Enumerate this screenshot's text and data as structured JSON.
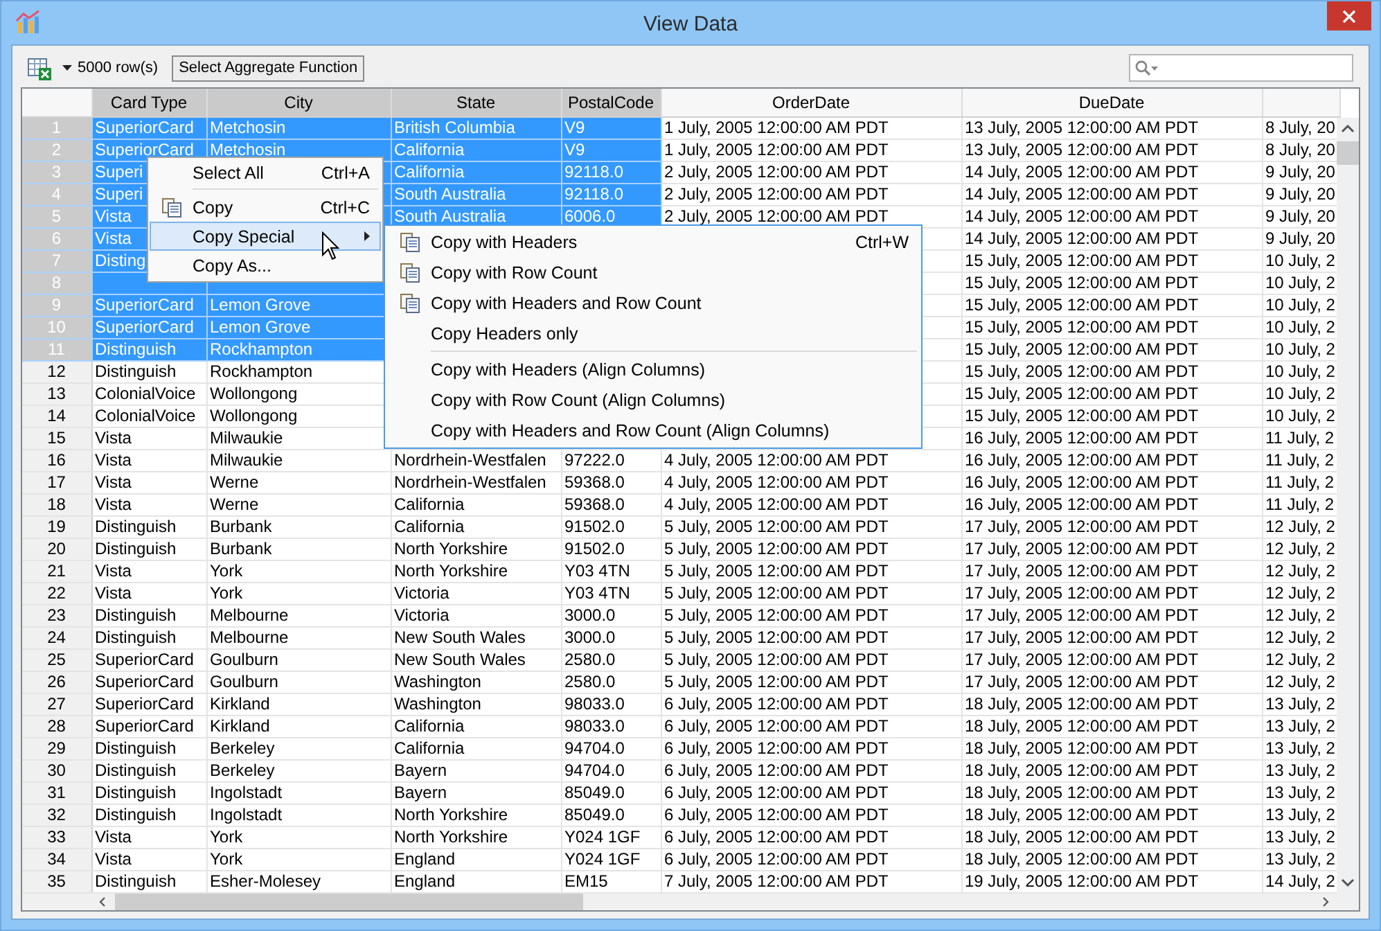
{
  "window": {
    "title": "View Data"
  },
  "toolbar": {
    "row_count": "5000 row(s)",
    "aggregate_button": "Select Aggregate Function"
  },
  "table": {
    "columns": [
      {
        "label": "Card Type",
        "selected": true
      },
      {
        "label": "City",
        "selected": true
      },
      {
        "label": "State",
        "selected": true
      },
      {
        "label": "PostalCode",
        "selected": true
      },
      {
        "label": "OrderDate",
        "selected": false
      },
      {
        "label": "DueDate",
        "selected": false
      }
    ],
    "rows": [
      {
        "number": "1",
        "selected": true,
        "cells": [
          "SuperiorCard",
          "Metchosin",
          "British Columbia",
          "V9",
          "1 July, 2005 12:00:00 AM PDT",
          "13 July, 2005 12:00:00 AM PDT",
          "8 July, 20"
        ]
      },
      {
        "number": "2",
        "selected": true,
        "cells": [
          "SuperiorCard",
          "Metchosin",
          "California",
          "V9",
          "1 July, 2005 12:00:00 AM PDT",
          "13 July, 2005 12:00:00 AM PDT",
          "8 July, 20"
        ]
      },
      {
        "number": "3",
        "selected": true,
        "cells": [
          "Superi",
          null,
          "California",
          "92118.0",
          "2 July, 2005 12:00:00 AM PDT",
          "14 July, 2005 12:00:00 AM PDT",
          "9 July, 20"
        ]
      },
      {
        "number": "4",
        "selected": true,
        "cells": [
          "Superi",
          null,
          "South Australia",
          "92118.0",
          "2 July, 2005 12:00:00 AM PDT",
          "14 July, 2005 12:00:00 AM PDT",
          "9 July, 20"
        ]
      },
      {
        "number": "5",
        "selected": true,
        "cells": [
          "Vista",
          null,
          "South Australia",
          "6006.0",
          "2 July, 2005 12:00:00 AM PDT",
          "14 July, 2005 12:00:00 AM PDT",
          "9 July, 20"
        ]
      },
      {
        "number": "6",
        "selected": true,
        "cells": [
          "Vista",
          null,
          null,
          null,
          null,
          "14 July, 2005 12:00:00 AM PDT",
          "9 July, 20"
        ]
      },
      {
        "number": "7",
        "selected": true,
        "cells": [
          "Disting",
          null,
          null,
          null,
          null,
          "15 July, 2005 12:00:00 AM PDT",
          "10 July, 2"
        ]
      },
      {
        "number": "8",
        "selected": true,
        "cells": [
          null,
          null,
          null,
          null,
          null,
          "15 July, 2005 12:00:00 AM PDT",
          "10 July, 2"
        ]
      },
      {
        "number": "9",
        "selected": true,
        "cells": [
          "SuperiorCard",
          "Lemon Grove",
          null,
          null,
          null,
          "15 July, 2005 12:00:00 AM PDT",
          "10 July, 2"
        ]
      },
      {
        "number": "10",
        "selected": true,
        "cells": [
          "SuperiorCard",
          "Lemon Grove",
          null,
          null,
          null,
          "15 July, 2005 12:00:00 AM PDT",
          "10 July, 2"
        ]
      },
      {
        "number": "11",
        "selected": true,
        "cells": [
          "Distinguish",
          "Rockhampton",
          null,
          null,
          null,
          "15 July, 2005 12:00:00 AM PDT",
          "10 July, 2"
        ]
      },
      {
        "number": "12",
        "selected": false,
        "cells": [
          "Distinguish",
          "Rockhampton",
          null,
          null,
          null,
          "15 July, 2005 12:00:00 AM PDT",
          "10 July, 2"
        ]
      },
      {
        "number": "13",
        "selected": false,
        "cells": [
          "ColonialVoice",
          "Wollongong",
          null,
          null,
          null,
          "15 July, 2005 12:00:00 AM PDT",
          "10 July, 2"
        ]
      },
      {
        "number": "14",
        "selected": false,
        "cells": [
          "ColonialVoice",
          "Wollongong",
          null,
          null,
          null,
          "15 July, 2005 12:00:00 AM PDT",
          "10 July, 2"
        ]
      },
      {
        "number": "15",
        "selected": false,
        "cells": [
          "Vista",
          "Milwaukie",
          null,
          null,
          null,
          "16 July, 2005 12:00:00 AM PDT",
          "11 July, 2"
        ]
      },
      {
        "number": "16",
        "selected": false,
        "cells": [
          "Vista",
          "Milwaukie",
          "Nordrhein-Westfalen",
          "97222.0",
          "4 July, 2005 12:00:00 AM PDT",
          "16 July, 2005 12:00:00 AM PDT",
          "11 July, 2"
        ]
      },
      {
        "number": "17",
        "selected": false,
        "cells": [
          "Vista",
          "Werne",
          "Nordrhein-Westfalen",
          "59368.0",
          "4 July, 2005 12:00:00 AM PDT",
          "16 July, 2005 12:00:00 AM PDT",
          "11 July, 2"
        ]
      },
      {
        "number": "18",
        "selected": false,
        "cells": [
          "Vista",
          "Werne",
          "California",
          "59368.0",
          "4 July, 2005 12:00:00 AM PDT",
          "16 July, 2005 12:00:00 AM PDT",
          "11 July, 2"
        ]
      },
      {
        "number": "19",
        "selected": false,
        "cells": [
          "Distinguish",
          "Burbank",
          "California",
          "91502.0",
          "5 July, 2005 12:00:00 AM PDT",
          "17 July, 2005 12:00:00 AM PDT",
          "12 July, 2"
        ]
      },
      {
        "number": "20",
        "selected": false,
        "cells": [
          "Distinguish",
          "Burbank",
          "North Yorkshire",
          "91502.0",
          "5 July, 2005 12:00:00 AM PDT",
          "17 July, 2005 12:00:00 AM PDT",
          "12 July, 2"
        ]
      },
      {
        "number": "21",
        "selected": false,
        "cells": [
          "Vista",
          "York",
          "North Yorkshire",
          "Y03 4TN",
          "5 July, 2005 12:00:00 AM PDT",
          "17 July, 2005 12:00:00 AM PDT",
          "12 July, 2"
        ]
      },
      {
        "number": "22",
        "selected": false,
        "cells": [
          "Vista",
          "York",
          "Victoria",
          "Y03 4TN",
          "5 July, 2005 12:00:00 AM PDT",
          "17 July, 2005 12:00:00 AM PDT",
          "12 July, 2"
        ]
      },
      {
        "number": "23",
        "selected": false,
        "cells": [
          "Distinguish",
          "Melbourne",
          "Victoria",
          "3000.0",
          "5 July, 2005 12:00:00 AM PDT",
          "17 July, 2005 12:00:00 AM PDT",
          "12 July, 2"
        ]
      },
      {
        "number": "24",
        "selected": false,
        "cells": [
          "Distinguish",
          "Melbourne",
          "New South Wales",
          "3000.0",
          "5 July, 2005 12:00:00 AM PDT",
          "17 July, 2005 12:00:00 AM PDT",
          "12 July, 2"
        ]
      },
      {
        "number": "25",
        "selected": false,
        "cells": [
          "SuperiorCard",
          "Goulburn",
          "New South Wales",
          "2580.0",
          "5 July, 2005 12:00:00 AM PDT",
          "17 July, 2005 12:00:00 AM PDT",
          "12 July, 2"
        ]
      },
      {
        "number": "26",
        "selected": false,
        "cells": [
          "SuperiorCard",
          "Goulburn",
          "Washington",
          "2580.0",
          "5 July, 2005 12:00:00 AM PDT",
          "17 July, 2005 12:00:00 AM PDT",
          "12 July, 2"
        ]
      },
      {
        "number": "27",
        "selected": false,
        "cells": [
          "SuperiorCard",
          "Kirkland",
          "Washington",
          "98033.0",
          "6 July, 2005 12:00:00 AM PDT",
          "18 July, 2005 12:00:00 AM PDT",
          "13 July, 2"
        ]
      },
      {
        "number": "28",
        "selected": false,
        "cells": [
          "SuperiorCard",
          "Kirkland",
          "California",
          "98033.0",
          "6 July, 2005 12:00:00 AM PDT",
          "18 July, 2005 12:00:00 AM PDT",
          "13 July, 2"
        ]
      },
      {
        "number": "29",
        "selected": false,
        "cells": [
          "Distinguish",
          "Berkeley",
          "California",
          "94704.0",
          "6 July, 2005 12:00:00 AM PDT",
          "18 July, 2005 12:00:00 AM PDT",
          "13 July, 2"
        ]
      },
      {
        "number": "30",
        "selected": false,
        "cells": [
          "Distinguish",
          "Berkeley",
          "Bayern",
          "94704.0",
          "6 July, 2005 12:00:00 AM PDT",
          "18 July, 2005 12:00:00 AM PDT",
          "13 July, 2"
        ]
      },
      {
        "number": "31",
        "selected": false,
        "cells": [
          "Distinguish",
          "Ingolstadt",
          "Bayern",
          "85049.0",
          "6 July, 2005 12:00:00 AM PDT",
          "18 July, 2005 12:00:00 AM PDT",
          "13 July, 2"
        ]
      },
      {
        "number": "32",
        "selected": false,
        "cells": [
          "Distinguish",
          "Ingolstadt",
          "North Yorkshire",
          "85049.0",
          "6 July, 2005 12:00:00 AM PDT",
          "18 July, 2005 12:00:00 AM PDT",
          "13 July, 2"
        ]
      },
      {
        "number": "33",
        "selected": false,
        "cells": [
          "Vista",
          "York",
          "North Yorkshire",
          "Y024 1GF",
          "6 July, 2005 12:00:00 AM PDT",
          "18 July, 2005 12:00:00 AM PDT",
          "13 July, 2"
        ]
      },
      {
        "number": "34",
        "selected": false,
        "cells": [
          "Vista",
          "York",
          "England",
          "Y024 1GF",
          "6 July, 2005 12:00:00 AM PDT",
          "18 July, 2005 12:00:00 AM PDT",
          "13 July, 2"
        ]
      },
      {
        "number": "35",
        "selected": false,
        "cells": [
          "Distinguish",
          "Esher-Molesey",
          "England",
          "EM15",
          "7 July, 2005 12:00:00 AM PDT",
          "19 July, 2005 12:00:00 AM PDT",
          "14 July, 2"
        ]
      }
    ]
  },
  "context_menu": {
    "items": [
      {
        "label": "Select All",
        "shortcut": "Ctrl+A",
        "has_icon": false,
        "highlighted": false,
        "submenu": false,
        "separator_after": true
      },
      {
        "label": "Copy",
        "shortcut": "Ctrl+C",
        "has_icon": true,
        "highlighted": false,
        "submenu": false,
        "separator_after": false
      },
      {
        "label": "Copy Special",
        "has_icon": false,
        "highlighted": true,
        "submenu": true,
        "separator_after": false
      },
      {
        "label": "Copy As...",
        "has_icon": false,
        "highlighted": false,
        "submenu": false,
        "separator_after": false
      }
    ]
  },
  "submenu": {
    "items": [
      {
        "label": "Copy with Headers",
        "shortcut": "Ctrl+W",
        "has_icon": true,
        "highlighted": false,
        "submenu": false,
        "separator_after": false
      },
      {
        "label": "Copy with Row Count",
        "has_icon": true,
        "highlighted": false,
        "submenu": false,
        "separator_after": false
      },
      {
        "label": "Copy with Headers and Row Count",
        "has_icon": true,
        "highlighted": false,
        "submenu": false,
        "separator_after": false
      },
      {
        "label": "Copy Headers only",
        "has_icon": false,
        "highlighted": false,
        "submenu": false,
        "separator_after": true
      },
      {
        "label": "Copy with Headers (Align Columns)",
        "has_icon": false,
        "highlighted": false,
        "submenu": false,
        "separator_after": false
      },
      {
        "label": "Copy with Row Count (Align Columns)",
        "has_icon": false,
        "highlighted": false,
        "submenu": false,
        "separator_after": false
      },
      {
        "label": "Copy with Headers and Row Count (Align Columns)",
        "has_icon": false,
        "highlighted": false,
        "submenu": false,
        "separator_after": false
      }
    ]
  }
}
